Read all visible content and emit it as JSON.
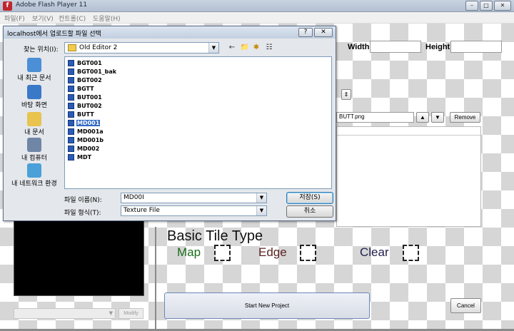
{
  "app": {
    "icon_glyph": "f",
    "title": "Adobe Flash Player 11",
    "window_buttons": [
      "–",
      "□",
      "✕"
    ],
    "menu": [
      "파일(F)",
      "보기(V)",
      "컨트롤(C)",
      "도움말(H)"
    ]
  },
  "editor": {
    "width_label": "Width:",
    "height_label": "Height:",
    "texture_filename": "BUTT.png",
    "up_glyph": "▲",
    "down_glyph": "▼",
    "spin_glyph": "⇕",
    "remove_label": "Remove",
    "tile_type_title": "Basic Tile Type",
    "tile_types": [
      {
        "label": "Map",
        "color": "#1c6b1c"
      },
      {
        "label": "Edge",
        "color": "#5a2323"
      },
      {
        "label": "Clear",
        "color": "#1f1f4d"
      }
    ],
    "start_label": "Start New Project",
    "cancel_label": "Cancel",
    "modify_label": "Modify",
    "select_arrow": "▼"
  },
  "dialog": {
    "title": "localhost에서 업로드할 파일 선택",
    "help": "?",
    "close": "✕",
    "lookin_label": "찾는 위치(I):",
    "lookin_value": "Old Editor 2",
    "toolbar_icons": [
      "←",
      "📁",
      "✱",
      "☷"
    ],
    "places": [
      {
        "label": "내 최근 문서",
        "color": "#4b8fd6"
      },
      {
        "label": "바탕 화면",
        "color": "#3a78c8"
      },
      {
        "label": "내 문서",
        "color": "#e8c34e"
      },
      {
        "label": "내 컴퓨터",
        "color": "#6f86a6"
      },
      {
        "label": "내 네트워크 환경",
        "color": "#4aa0d8"
      }
    ],
    "files": [
      "BGT001",
      "BGT001_bak",
      "BGT002",
      "BGTT",
      "BUT001",
      "BUT002",
      "BUTT",
      "MD001",
      "MD001a",
      "MD001b",
      "MD002",
      "MDT"
    ],
    "selected_file": "MD001",
    "filename_label": "파일 이름(N):",
    "filename_value": "MD00I",
    "filetype_label": "파일 형식(T):",
    "filetype_value": "Texture File",
    "open_label": "저장(S)",
    "cancel_label": "취소",
    "combo_arrow": "▼"
  }
}
